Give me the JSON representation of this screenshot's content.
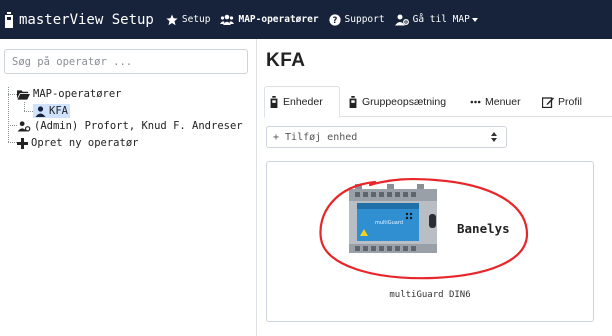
{
  "navbar": {
    "brand": "masterView Setup",
    "items": [
      {
        "label": "Setup",
        "icon": "star-icon"
      },
      {
        "label": "MAP-operatører",
        "icon": "users-icon"
      },
      {
        "label": "Support",
        "icon": "question-circle-icon"
      },
      {
        "label": "Gå til MAP",
        "icon": "user-gear-icon"
      }
    ],
    "bg_color": "#16233a"
  },
  "sidebar": {
    "search_placeholder": "Søg på operatør ...",
    "tree": {
      "root": "MAP-operatører",
      "selected_child": "KFA",
      "admin": "(Admin) Profort, Knud F. Andreser",
      "create": "Opret ny operatør"
    }
  },
  "main": {
    "title": "KFA",
    "tabs": [
      {
        "label": "Enheder",
        "icon": "device-icon",
        "active": true
      },
      {
        "label": "Gruppeopsætning",
        "icon": "device-icon",
        "active": false
      },
      {
        "label": "Menuer",
        "icon": "ellipsis-icon",
        "active": false
      },
      {
        "label": "Profil",
        "icon": "edit-icon",
        "active": false
      }
    ],
    "add_device_label": "+ Tilføj enhed",
    "device": {
      "name": "multiGuard DIN6",
      "annotation": "Banelys"
    }
  },
  "colors": {
    "accent": "#1a3e6a",
    "selection": "#cfe3ff",
    "annotation": "#e8262a"
  }
}
